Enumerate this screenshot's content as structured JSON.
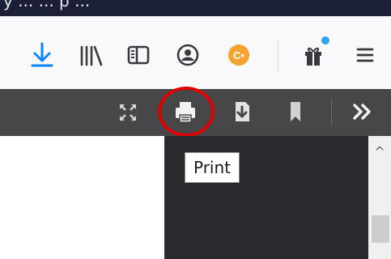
{
  "top_strip": {
    "clipped_text": "y ... ... p ..."
  },
  "nav_toolbar": {
    "icons": [
      {
        "name": "download-icon",
        "color": "#0a84ff"
      },
      {
        "name": "library-icon",
        "color": "#3a3a3e"
      },
      {
        "name": "sidebar-icon",
        "color": "#3a3a3e"
      },
      {
        "name": "account-icon",
        "color": "#3a3a3e"
      },
      {
        "name": "extension-icon",
        "color": "#f4a230",
        "glyph_text": "C•"
      },
      {
        "name": "gift-icon",
        "color": "#3a3a3e",
        "badge_color": "#2ea3f2"
      },
      {
        "name": "menu-icon",
        "color": "#3a3a3e"
      }
    ]
  },
  "pdf_toolbar": {
    "buttons": [
      {
        "name": "presentation-mode-icon"
      },
      {
        "name": "print-icon",
        "highlighted": true,
        "highlight_color": "#e00000"
      },
      {
        "name": "save-download-icon"
      },
      {
        "name": "bookmark-icon"
      },
      {
        "name": "tools-chevron-icon"
      }
    ]
  },
  "tooltip": {
    "text": "Print"
  },
  "scrollbar": {
    "up_arrow": "^"
  }
}
